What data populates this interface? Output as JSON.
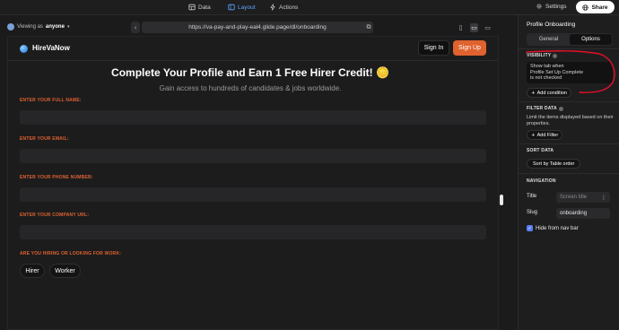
{
  "topbar": {
    "tabs": [
      {
        "label": "Data",
        "icon": "data-table-icon"
      },
      {
        "label": "Layout",
        "icon": "layout-icon",
        "active": true
      },
      {
        "label": "Actions",
        "icon": "lightning-icon"
      }
    ],
    "settings_label": "Settings",
    "share_label": "Share"
  },
  "preview": {
    "viewing_prefix": "Viewing as",
    "viewing_user": "anyone",
    "url": "https://va-pay-and-play-eal4.glide.page/dl/onboarding"
  },
  "app": {
    "brand": "HireVaNow",
    "signin_label": "Sign In",
    "signup_label": "Sign Up",
    "title": "Complete Your Profile and Earn 1 Free Hirer Credit! 🪙",
    "subtitle": "Gain access to hundreds of candidates & jobs worldwide.",
    "fields": [
      {
        "label": "ENTER YOUR FULL NAME:",
        "value": ""
      },
      {
        "label": "ENTER YOUR EMAIL:",
        "value": ""
      },
      {
        "label": "ENTER YOUR PHONE NUMBER:",
        "value": ""
      },
      {
        "label": "ENTER YOUR COMPANY URL:",
        "value": ""
      }
    ],
    "choice_label": "ARE YOU HIRING OR LOOKING FOR WORK:",
    "choices": [
      "Hirer",
      "Worker"
    ]
  },
  "panel": {
    "title": "Profile Onboarding",
    "tabs": [
      "General",
      "Options"
    ],
    "active_tab": "Options",
    "visibility": {
      "heading": "VISIBILITY",
      "rule_line1": "Show tab when",
      "rule_line2": "Profile Set Up Complete",
      "rule_line3": "is not checked",
      "add_condition": "Add condition"
    },
    "filter": {
      "heading": "FILTER DATA",
      "description": "Limit the items displayed based on their properties.",
      "add_filter": "Add Filter"
    },
    "sort": {
      "heading": "SORT DATA",
      "value": "Sort by Table order"
    },
    "navigation": {
      "heading": "NAVIGATION",
      "title_label": "Title",
      "title_placeholder": "Screen title",
      "slug_label": "Slug",
      "slug_value": "onboarding",
      "hide_label": "Hide from nav bar",
      "hide_checked": true
    }
  },
  "colors": {
    "accent_orange": "#e0622f",
    "annotation_red": "#e8102a",
    "active_blue": "#5aa7ff",
    "checkbox_blue": "#5b7ff0"
  }
}
